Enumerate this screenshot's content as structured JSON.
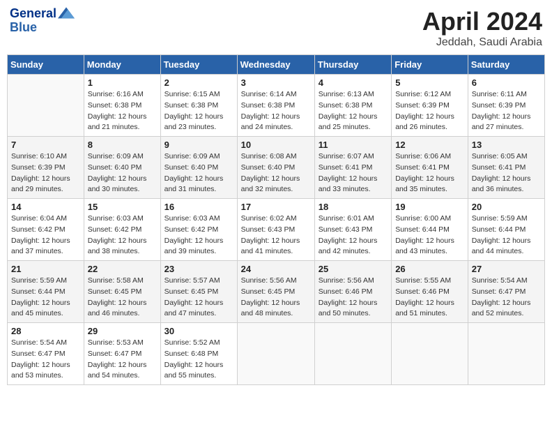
{
  "header": {
    "logo_line1": "General",
    "logo_line2": "Blue",
    "month": "April 2024",
    "location": "Jeddah, Saudi Arabia"
  },
  "days_of_week": [
    "Sunday",
    "Monday",
    "Tuesday",
    "Wednesday",
    "Thursday",
    "Friday",
    "Saturday"
  ],
  "weeks": [
    [
      {
        "day": "",
        "sunrise": "",
        "sunset": "",
        "daylight": ""
      },
      {
        "day": "1",
        "sunrise": "Sunrise: 6:16 AM",
        "sunset": "Sunset: 6:38 PM",
        "daylight": "Daylight: 12 hours and 21 minutes."
      },
      {
        "day": "2",
        "sunrise": "Sunrise: 6:15 AM",
        "sunset": "Sunset: 6:38 PM",
        "daylight": "Daylight: 12 hours and 23 minutes."
      },
      {
        "day": "3",
        "sunrise": "Sunrise: 6:14 AM",
        "sunset": "Sunset: 6:38 PM",
        "daylight": "Daylight: 12 hours and 24 minutes."
      },
      {
        "day": "4",
        "sunrise": "Sunrise: 6:13 AM",
        "sunset": "Sunset: 6:38 PM",
        "daylight": "Daylight: 12 hours and 25 minutes."
      },
      {
        "day": "5",
        "sunrise": "Sunrise: 6:12 AM",
        "sunset": "Sunset: 6:39 PM",
        "daylight": "Daylight: 12 hours and 26 minutes."
      },
      {
        "day": "6",
        "sunrise": "Sunrise: 6:11 AM",
        "sunset": "Sunset: 6:39 PM",
        "daylight": "Daylight: 12 hours and 27 minutes."
      }
    ],
    [
      {
        "day": "7",
        "sunrise": "Sunrise: 6:10 AM",
        "sunset": "Sunset: 6:39 PM",
        "daylight": "Daylight: 12 hours and 29 minutes."
      },
      {
        "day": "8",
        "sunrise": "Sunrise: 6:09 AM",
        "sunset": "Sunset: 6:40 PM",
        "daylight": "Daylight: 12 hours and 30 minutes."
      },
      {
        "day": "9",
        "sunrise": "Sunrise: 6:09 AM",
        "sunset": "Sunset: 6:40 PM",
        "daylight": "Daylight: 12 hours and 31 minutes."
      },
      {
        "day": "10",
        "sunrise": "Sunrise: 6:08 AM",
        "sunset": "Sunset: 6:40 PM",
        "daylight": "Daylight: 12 hours and 32 minutes."
      },
      {
        "day": "11",
        "sunrise": "Sunrise: 6:07 AM",
        "sunset": "Sunset: 6:41 PM",
        "daylight": "Daylight: 12 hours and 33 minutes."
      },
      {
        "day": "12",
        "sunrise": "Sunrise: 6:06 AM",
        "sunset": "Sunset: 6:41 PM",
        "daylight": "Daylight: 12 hours and 35 minutes."
      },
      {
        "day": "13",
        "sunrise": "Sunrise: 6:05 AM",
        "sunset": "Sunset: 6:41 PM",
        "daylight": "Daylight: 12 hours and 36 minutes."
      }
    ],
    [
      {
        "day": "14",
        "sunrise": "Sunrise: 6:04 AM",
        "sunset": "Sunset: 6:42 PM",
        "daylight": "Daylight: 12 hours and 37 minutes."
      },
      {
        "day": "15",
        "sunrise": "Sunrise: 6:03 AM",
        "sunset": "Sunset: 6:42 PM",
        "daylight": "Daylight: 12 hours and 38 minutes."
      },
      {
        "day": "16",
        "sunrise": "Sunrise: 6:03 AM",
        "sunset": "Sunset: 6:42 PM",
        "daylight": "Daylight: 12 hours and 39 minutes."
      },
      {
        "day": "17",
        "sunrise": "Sunrise: 6:02 AM",
        "sunset": "Sunset: 6:43 PM",
        "daylight": "Daylight: 12 hours and 41 minutes."
      },
      {
        "day": "18",
        "sunrise": "Sunrise: 6:01 AM",
        "sunset": "Sunset: 6:43 PM",
        "daylight": "Daylight: 12 hours and 42 minutes."
      },
      {
        "day": "19",
        "sunrise": "Sunrise: 6:00 AM",
        "sunset": "Sunset: 6:44 PM",
        "daylight": "Daylight: 12 hours and 43 minutes."
      },
      {
        "day": "20",
        "sunrise": "Sunrise: 5:59 AM",
        "sunset": "Sunset: 6:44 PM",
        "daylight": "Daylight: 12 hours and 44 minutes."
      }
    ],
    [
      {
        "day": "21",
        "sunrise": "Sunrise: 5:59 AM",
        "sunset": "Sunset: 6:44 PM",
        "daylight": "Daylight: 12 hours and 45 minutes."
      },
      {
        "day": "22",
        "sunrise": "Sunrise: 5:58 AM",
        "sunset": "Sunset: 6:45 PM",
        "daylight": "Daylight: 12 hours and 46 minutes."
      },
      {
        "day": "23",
        "sunrise": "Sunrise: 5:57 AM",
        "sunset": "Sunset: 6:45 PM",
        "daylight": "Daylight: 12 hours and 47 minutes."
      },
      {
        "day": "24",
        "sunrise": "Sunrise: 5:56 AM",
        "sunset": "Sunset: 6:45 PM",
        "daylight": "Daylight: 12 hours and 48 minutes."
      },
      {
        "day": "25",
        "sunrise": "Sunrise: 5:56 AM",
        "sunset": "Sunset: 6:46 PM",
        "daylight": "Daylight: 12 hours and 50 minutes."
      },
      {
        "day": "26",
        "sunrise": "Sunrise: 5:55 AM",
        "sunset": "Sunset: 6:46 PM",
        "daylight": "Daylight: 12 hours and 51 minutes."
      },
      {
        "day": "27",
        "sunrise": "Sunrise: 5:54 AM",
        "sunset": "Sunset: 6:47 PM",
        "daylight": "Daylight: 12 hours and 52 minutes."
      }
    ],
    [
      {
        "day": "28",
        "sunrise": "Sunrise: 5:54 AM",
        "sunset": "Sunset: 6:47 PM",
        "daylight": "Daylight: 12 hours and 53 minutes."
      },
      {
        "day": "29",
        "sunrise": "Sunrise: 5:53 AM",
        "sunset": "Sunset: 6:47 PM",
        "daylight": "Daylight: 12 hours and 54 minutes."
      },
      {
        "day": "30",
        "sunrise": "Sunrise: 5:52 AM",
        "sunset": "Sunset: 6:48 PM",
        "daylight": "Daylight: 12 hours and 55 minutes."
      },
      {
        "day": "",
        "sunrise": "",
        "sunset": "",
        "daylight": ""
      },
      {
        "day": "",
        "sunrise": "",
        "sunset": "",
        "daylight": ""
      },
      {
        "day": "",
        "sunrise": "",
        "sunset": "",
        "daylight": ""
      },
      {
        "day": "",
        "sunrise": "",
        "sunset": "",
        "daylight": ""
      }
    ]
  ]
}
